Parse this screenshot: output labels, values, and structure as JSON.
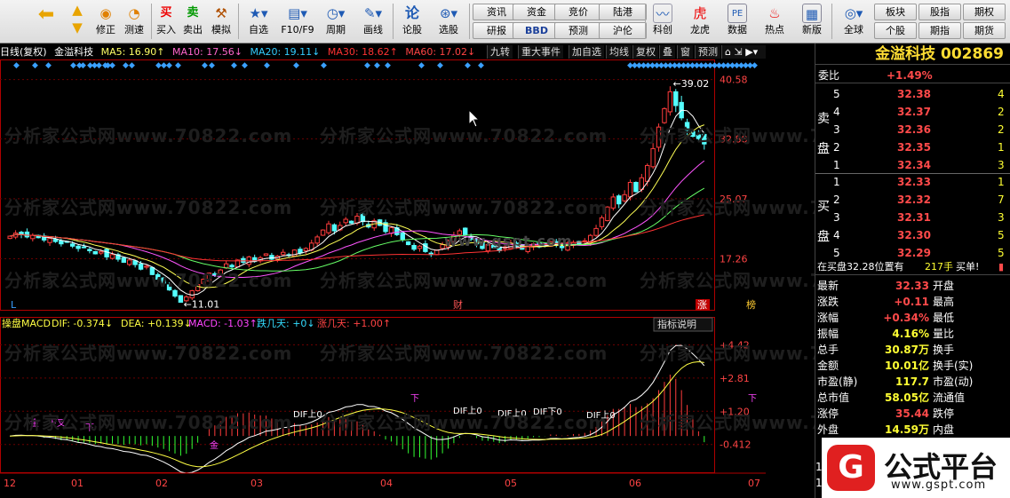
{
  "toolbar": {
    "items": [
      {
        "label": "",
        "icon": "back-arrow-icon"
      },
      {
        "label": "",
        "icon": "up-arrow-icon"
      },
      {
        "label": "修正",
        "icon": "fix-icon"
      },
      {
        "label": "测速",
        "icon": "speed-test-icon"
      },
      {
        "label": "买入",
        "icon": "buy-icon"
      },
      {
        "label": "卖出",
        "icon": "sell-icon"
      },
      {
        "label": "模拟",
        "icon": "gavel-icon"
      },
      {
        "label": "自选",
        "icon": "star-folder-icon"
      },
      {
        "label": "F10/F9",
        "icon": "f10-icon"
      },
      {
        "label": "周期",
        "icon": "clock-icon"
      },
      {
        "label": "画线",
        "icon": "pencil-icon"
      },
      {
        "label": "论股",
        "icon": "discuss-icon"
      },
      {
        "label": "选股",
        "icon": "stock-picker-icon"
      }
    ],
    "buttons_row1": [
      "资讯",
      "资金",
      "竞价",
      "陆港"
    ],
    "buttons_row2": [
      "研报",
      "BBD",
      "预测",
      "沪伦"
    ],
    "items2": [
      {
        "label": "科创",
        "icon": "kechuang-icon"
      },
      {
        "label": "龙虎",
        "icon": "dragon-tiger-icon"
      },
      {
        "label": "数据",
        "icon": "pe-data-icon"
      },
      {
        "label": "热点",
        "icon": "hot-icon"
      },
      {
        "label": "新版",
        "icon": "new-version-icon"
      },
      {
        "label": "全球",
        "icon": "globe-icon"
      }
    ],
    "buttons_row1b": [
      "板块",
      "股指",
      "期权"
    ],
    "buttons_row2b": [
      "个股",
      "期指",
      "期货"
    ]
  },
  "chart_header": {
    "period": "日线(复权)",
    "stock": "金溢科技",
    "ma5": "MA5: 16.90↑",
    "ma10": "MA10: 17.56↓",
    "ma20": "MA20: 19.11↓",
    "ma30": "MA30: 18.62↑",
    "ma60": "MA60: 17.02↓",
    "buttons": [
      "九转",
      "重大事件",
      "加自选",
      "均线",
      "复权",
      "叠",
      "窗",
      "预测"
    ]
  },
  "price_axis": [
    "40.58",
    "32.88",
    "25.07",
    "17.26"
  ],
  "high_label": "←39.02",
  "low_label": "←11.01",
  "markers": [
    "L",
    "财",
    "涨",
    "榜"
  ],
  "macd": {
    "title": "操盘MACD",
    "dif": "DIF: -0.374↓",
    "dea": "DEA: +0.139↓",
    "macd": "MACD: -1.03↑",
    "down_days": "跌几天: +0↓",
    "up_days": "涨几天: +1.00↑",
    "help": "指标说明",
    "axis": [
      "+4.42",
      "+2.81",
      "+1.20",
      "-0.412"
    ],
    "signals": [
      "金",
      "下叉",
      "下",
      "DIF上0",
      "DIF上0",
      "DIF上0",
      "DIF下0",
      "DIF上0",
      "下",
      "下",
      "金"
    ]
  },
  "x_axis": [
    "12",
    "01",
    "02",
    "03",
    "04",
    "05",
    "06",
    "07"
  ],
  "watermark": "分析家公式网www.70822.com",
  "watermark2": "www.gspt.com",
  "side": {
    "name": "金溢科技",
    "code": "002869",
    "weibi_label": "委比",
    "weibi": "+1.49%",
    "sell_label": "卖盘",
    "buy_label": "买盘",
    "sell": [
      {
        "n": "5",
        "p": "32.38",
        "v": "4"
      },
      {
        "n": "4",
        "p": "32.37",
        "v": "2"
      },
      {
        "n": "3",
        "p": "32.36",
        "v": "2"
      },
      {
        "n": "2",
        "p": "32.35",
        "v": "1"
      },
      {
        "n": "1",
        "p": "32.34",
        "v": "3"
      }
    ],
    "buy": [
      {
        "n": "1",
        "p": "32.33",
        "v": "1"
      },
      {
        "n": "2",
        "p": "32.32",
        "v": "7"
      },
      {
        "n": "3",
        "p": "32.31",
        "v": "3"
      },
      {
        "n": "4",
        "p": "32.30",
        "v": "5"
      },
      {
        "n": "5",
        "p": "32.29",
        "v": "5"
      }
    ],
    "position": "在买盘32.28位置有",
    "position_vol": "217手",
    "buy1": "买单!",
    "quote": [
      {
        "l1": "最新",
        "v1": "32.33",
        "l2": "开盘",
        "v2": ""
      },
      {
        "l1": "涨跌",
        "v1": "+0.11",
        "l2": "最高",
        "v2": ""
      },
      {
        "l1": "涨幅",
        "v1": "+0.34%",
        "l2": "最低",
        "v2": ""
      },
      {
        "l1": "振幅",
        "v1": "4.16%",
        "l2": "量比",
        "v2": ""
      },
      {
        "l1": "总手",
        "v1": "30.87万",
        "l2": "换手",
        "v2": ""
      },
      {
        "l1": "金额",
        "v1": "10.01亿",
        "l2": "换手(实)",
        "v2": ""
      },
      {
        "l1": "市盈(静)",
        "v1": "117.7",
        "l2": "市盈(动)",
        "v2": ""
      },
      {
        "l1": "总市值",
        "v1": "58.05亿",
        "l2": "流通值",
        "v2": ""
      },
      {
        "l1": "涨停",
        "v1": "35.44",
        "l2": "跌停",
        "v2": ""
      },
      {
        "l1": "外盘",
        "v1": "14.59万",
        "l2": "内盘",
        "v2": ""
      }
    ],
    "tail": [
      "1",
      "1"
    ]
  },
  "logo": {
    "brand": "公式平台",
    "url": "www.gspt.com"
  }
}
